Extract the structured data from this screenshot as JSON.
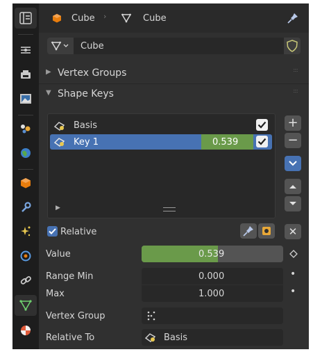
{
  "header": {
    "object_name": "Cube",
    "mesh_name": "Cube"
  },
  "datablock": {
    "name": "Cube"
  },
  "panels": {
    "vertex_groups": "Vertex Groups",
    "shape_keys": "Shape Keys"
  },
  "shape_keys": [
    {
      "name": "Basis",
      "value": "",
      "checked": true,
      "selected": false
    },
    {
      "name": "Key 1",
      "value": "0.539",
      "checked": true,
      "selected": true
    }
  ],
  "relative": {
    "label": "Relative",
    "checked": true
  },
  "properties": {
    "value_label": "Value",
    "value": "0.539",
    "value_fraction": 0.539,
    "range_min_label": "Range Min",
    "range_min": "0.000",
    "max_label": "Max",
    "max": "1.000",
    "vertex_group_label": "Vertex Group",
    "relative_to_label": "Relative To",
    "relative_to": "Basis"
  },
  "colors": {
    "accent_blue": "#4772b3",
    "value_green": "#6a9a4a",
    "orange": "#e87d0d"
  }
}
